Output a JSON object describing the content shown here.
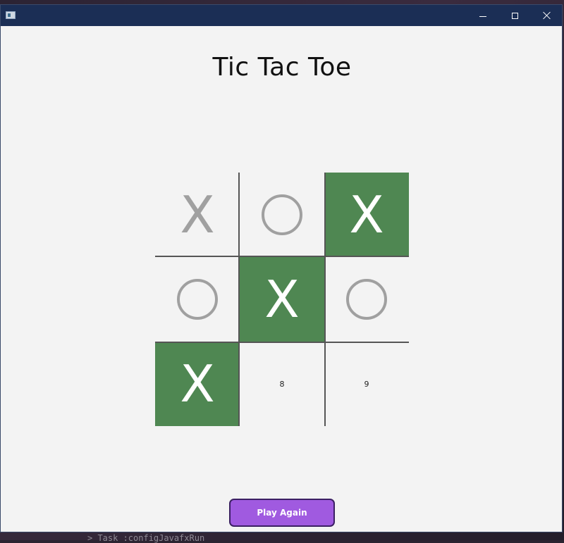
{
  "window": {
    "icon": "app-window-icon",
    "controls": {
      "minimize_icon": "minimize-icon",
      "maximize_icon": "maximize-icon",
      "close_icon": "close-icon"
    }
  },
  "background": {
    "terminal_text": "> Task :configJavafxRun"
  },
  "game": {
    "title": "Tic Tac Toe",
    "board": [
      {
        "mark": "X",
        "win": false,
        "label": ""
      },
      {
        "mark": "O",
        "win": false,
        "label": ""
      },
      {
        "mark": "X",
        "win": true,
        "label": ""
      },
      {
        "mark": "O",
        "win": false,
        "label": ""
      },
      {
        "mark": "X",
        "win": true,
        "label": ""
      },
      {
        "mark": "O",
        "win": false,
        "label": ""
      },
      {
        "mark": "X",
        "win": true,
        "label": ""
      },
      {
        "mark": "",
        "win": false,
        "label": "8"
      },
      {
        "mark": "",
        "win": false,
        "label": "9"
      }
    ],
    "play_again_label": "Play Again"
  },
  "colors": {
    "titlebar": "#1b2e55",
    "win_cell": "#4f8752",
    "mark": "#a0a0a0",
    "button": "#a05ae0",
    "button_border": "#3b1f63"
  }
}
